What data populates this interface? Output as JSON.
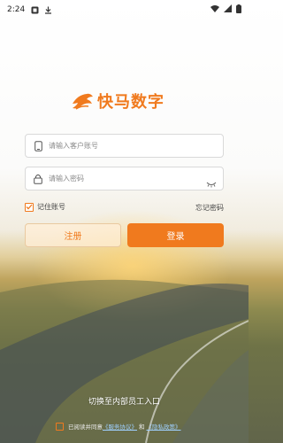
{
  "status_bar": {
    "time": "2:24",
    "left_icons": [
      "notification-icon",
      "download-icon"
    ],
    "right_icons": [
      "wifi-icon",
      "signal-icon",
      "battery-icon"
    ]
  },
  "brand": {
    "name": "快马数字",
    "accent": "#f07a1e"
  },
  "account_field": {
    "placeholder": "请输入客户账号",
    "value": ""
  },
  "password_field": {
    "placeholder": "请输入密码",
    "value": ""
  },
  "remember": {
    "label": "记住账号",
    "checked": true
  },
  "forgot_label": "忘记密码",
  "register_label": "注册",
  "login_label": "登录",
  "switch_label": "切换至内部员工入口",
  "agreement": {
    "prefix": "已阅读并同意",
    "service_link": "《服务协议》",
    "and": "和",
    "privacy_link": "《隐私政策》",
    "checked": false
  }
}
